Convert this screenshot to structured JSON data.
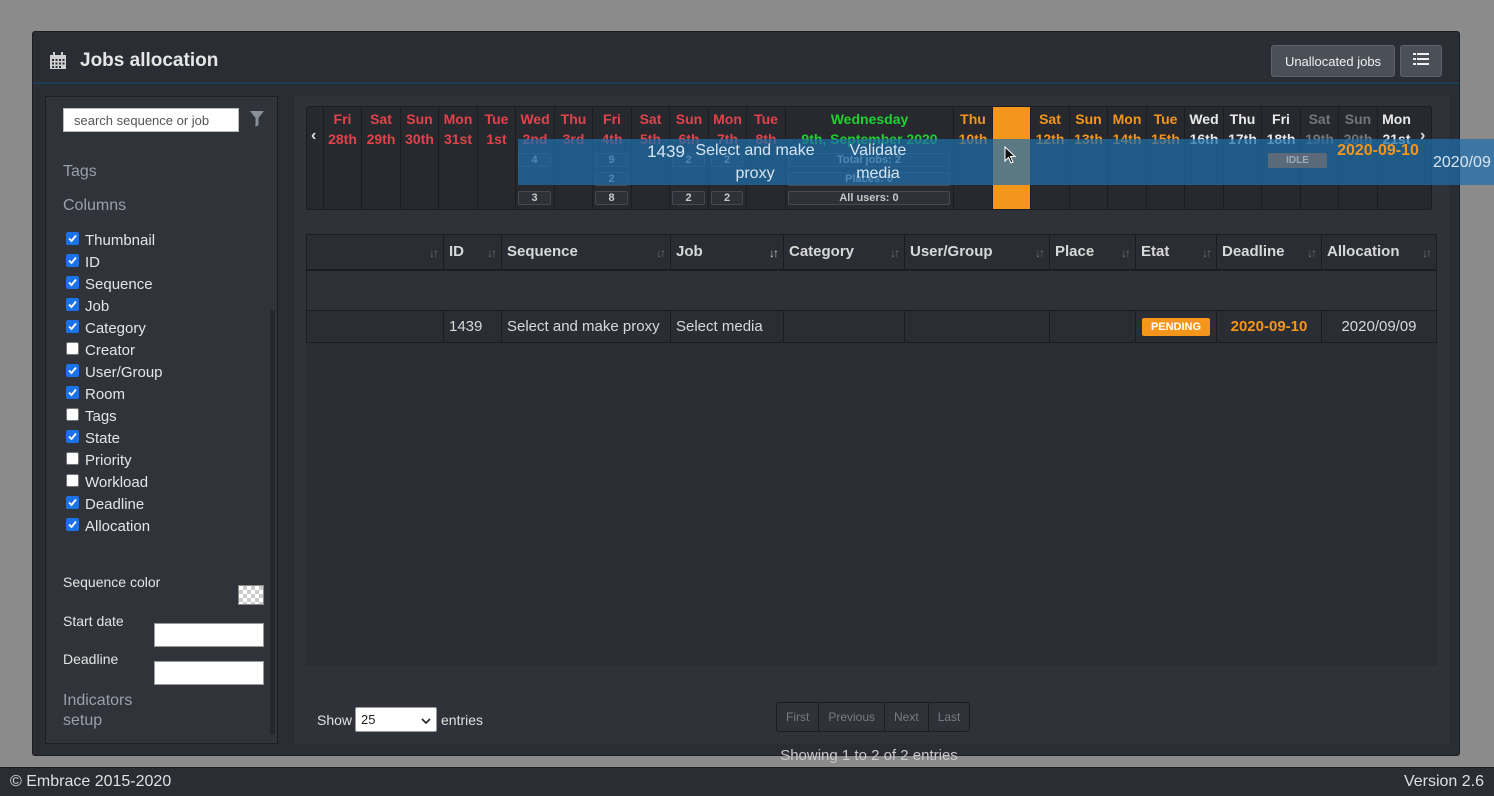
{
  "header": {
    "title": "Jobs allocation",
    "calendar_icon": "calendar-icon",
    "unallocated_label": "Unallocated jobs",
    "list_icon": "list-icon"
  },
  "sidebar": {
    "search_placeholder": "search sequence or job",
    "filter_icon": "filter-icon",
    "tags_heading": "Tags",
    "columns_heading": "Columns",
    "columns": [
      {
        "label": "Thumbnail",
        "checked": true
      },
      {
        "label": "ID",
        "checked": true
      },
      {
        "label": "Sequence",
        "checked": true
      },
      {
        "label": "Job",
        "checked": true
      },
      {
        "label": "Category",
        "checked": true
      },
      {
        "label": "Creator",
        "checked": false
      },
      {
        "label": "User/Group",
        "checked": true
      },
      {
        "label": "Room",
        "checked": true
      },
      {
        "label": "Tags",
        "checked": false
      },
      {
        "label": "State",
        "checked": true
      },
      {
        "label": "Priority",
        "checked": false
      },
      {
        "label": "Workload",
        "checked": false
      },
      {
        "label": "Deadline",
        "checked": true
      },
      {
        "label": "Allocation",
        "checked": true
      }
    ],
    "sequence_color_label": "Sequence color",
    "start_date_label": "Start date",
    "deadline_label": "Deadline",
    "indicators_heading_1": "Indicators",
    "indicators_heading_2": "setup"
  },
  "timeline": {
    "days": [
      {
        "l1": "Fri",
        "l2": "28th",
        "color": "red"
      },
      {
        "l1": "Sat",
        "l2": "29th",
        "color": "red"
      },
      {
        "l1": "Sun",
        "l2": "30th",
        "color": "red"
      },
      {
        "l1": "Mon",
        "l2": "31st",
        "color": "red"
      },
      {
        "l1": "Tue",
        "l2": "1st",
        "color": "red"
      },
      {
        "l1": "Wed",
        "l2": "2nd",
        "color": "red"
      },
      {
        "l1": "Thu",
        "l2": "3rd",
        "color": "red"
      },
      {
        "l1": "Fri",
        "l2": "4th",
        "color": "red"
      },
      {
        "l1": "Sat",
        "l2": "5th",
        "color": "red"
      },
      {
        "l1": "Sun",
        "l2": "6th",
        "color": "red"
      },
      {
        "l1": "Mon",
        "l2": "7th",
        "color": "red"
      },
      {
        "l1": "Tue",
        "l2": "8th",
        "color": "red"
      },
      {
        "l1": "Wednesday",
        "l2": "9th, September 2020",
        "color": "green"
      },
      {
        "l1": "Thu",
        "l2": "10th",
        "color": "orange"
      },
      {
        "l1": "",
        "l2": "",
        "color": "highlight"
      },
      {
        "l1": "Sat",
        "l2": "12th",
        "color": "orange"
      },
      {
        "l1": "Sun",
        "l2": "13th",
        "color": "orange"
      },
      {
        "l1": "Mon",
        "l2": "14th",
        "color": "orange"
      },
      {
        "l1": "Tue",
        "l2": "15th",
        "color": "orange"
      },
      {
        "l1": "Wed",
        "l2": "16th",
        "color": "white"
      },
      {
        "l1": "Thu",
        "l2": "17th",
        "color": "white"
      },
      {
        "l1": "Fri",
        "l2": "18th",
        "color": "white"
      },
      {
        "l1": "Sat",
        "l2": "19th",
        "color": "dim"
      },
      {
        "l1": "Sun",
        "l2": "20th",
        "color": "dim"
      },
      {
        "l1": "Mon",
        "l2": "21st",
        "color": "white"
      }
    ],
    "counts_row1": [
      {
        "day": 5,
        "v": "4"
      },
      {
        "day": 7,
        "v": "9"
      },
      {
        "day": 9,
        "v": "2"
      },
      {
        "day": 10,
        "v": "2"
      }
    ],
    "counts_row2": [
      {
        "day": 7,
        "v": "2"
      }
    ],
    "counts_row3": [
      {
        "day": 5,
        "v": "3"
      },
      {
        "day": 7,
        "v": "8"
      },
      {
        "day": 9,
        "v": "2"
      },
      {
        "day": 10,
        "v": "2"
      }
    ],
    "today_total_jobs": "Total jobs: 2",
    "today_places": "Places: 0",
    "today_all_users": "All users: 0",
    "drag_id": "1439",
    "drag_sequence": "Select and make proxy",
    "drag_job": "Validate media",
    "drag_state": "IDLE",
    "drag_deadline": "2020-09-10",
    "drag_allocation": "2020/09"
  },
  "table": {
    "headers": [
      "",
      "ID",
      "Sequence",
      "Job",
      "Category",
      "User/Group",
      "Place",
      "Etat",
      "Deadline",
      "Allocation"
    ],
    "rows": [
      {
        "thumbnail": "",
        "id": "1439",
        "sequence": "Select and make proxy",
        "job": "Select media",
        "category": "",
        "user_group": "",
        "place": "",
        "etat": "PENDING",
        "deadline": "2020-09-10",
        "allocation": "2020/09/09"
      }
    ]
  },
  "pagination": {
    "show_label": "Show",
    "page_size": "25",
    "entries_label": "entries",
    "first": "First",
    "previous": "Previous",
    "next": "Next",
    "last": "Last",
    "summary": "Showing 1 to 2 of 2 entries"
  },
  "footer": {
    "copyright": "© Embrace 2015-2020",
    "version": "Version 2.6"
  }
}
